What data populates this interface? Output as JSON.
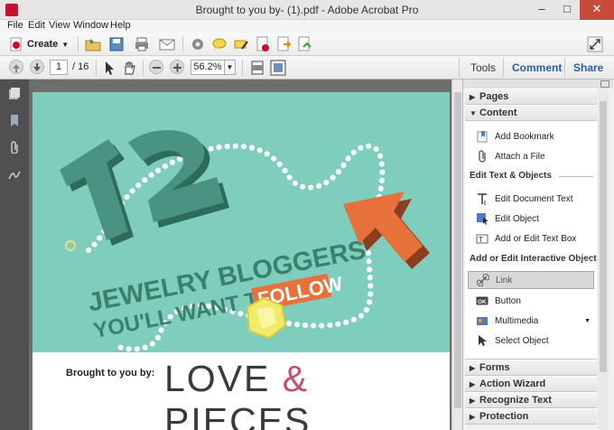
{
  "window": {
    "title": "Brought to you by- (1).pdf - Adobe Acrobat Pro"
  },
  "menu": [
    "File",
    "Edit",
    "View",
    "Window",
    "Help"
  ],
  "toolbar": {
    "create_label": "Create"
  },
  "nav": {
    "current_page": "1",
    "total_pages": "/ 16",
    "zoom": "56.2%"
  },
  "tabs": [
    "Tools",
    "Comment",
    "Share"
  ],
  "panel": {
    "sections_top": [
      "Pages",
      "Content"
    ],
    "groups": {
      "top_items": [
        "Add Bookmark",
        "Attach a File"
      ],
      "edit_label": "Edit Text & Objects",
      "edit_items": [
        "Edit Document Text",
        "Edit Object",
        "Add or Edit Text Box"
      ],
      "interactive_label": "Add or Edit Interactive Object",
      "interactive_items": [
        "Link",
        "Button",
        "Multimedia",
        "Select Object"
      ]
    },
    "sections_bottom": [
      "Forms",
      "Action Wizard",
      "Recognize Text",
      "Protection"
    ]
  },
  "document": {
    "footer_left": "Brought to you by:",
    "brand_left": "LOVE",
    "brand_amp": "&",
    "brand_right": "PIECES",
    "headline_number": "12",
    "headline_line1": "JEWELRY BLOGGERS",
    "headline_line2": "YOU'LL WANT TO",
    "headline_follow": "FOLLOW"
  },
  "colors": {
    "page_bg": "#7fcebd",
    "accent_orange": "#e8703a",
    "dark_teal": "#3c7f6f",
    "love_amp": "#c0506b"
  }
}
